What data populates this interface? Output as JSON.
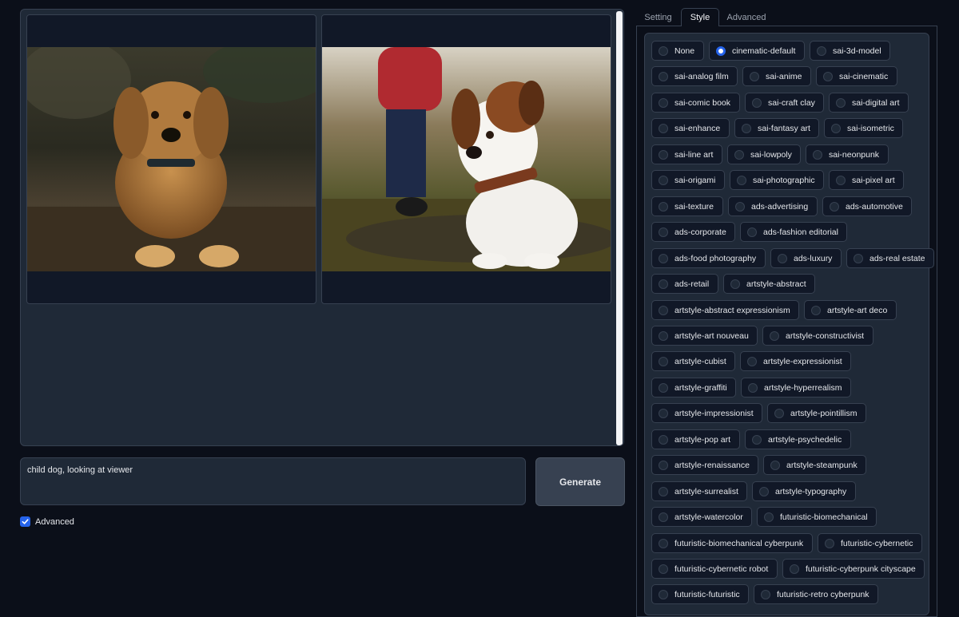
{
  "gallery": {
    "images": [
      {
        "name": "golden-retriever-puppy"
      },
      {
        "name": "jack-russell-puppy"
      }
    ]
  },
  "prompt": {
    "value": "child dog, looking at viewer"
  },
  "generate_label": "Generate",
  "advanced_checkbox": {
    "label": "Advanced",
    "checked": true
  },
  "tabs": [
    {
      "label": "Setting",
      "selected": false
    },
    {
      "label": "Style",
      "selected": true
    },
    {
      "label": "Advanced",
      "selected": false
    }
  ],
  "styles": {
    "selected": "cinematic-default",
    "rows": [
      [
        "None",
        "cinematic-default",
        "sai-3d-model"
      ],
      [
        "sai-analog film",
        "sai-anime",
        "sai-cinematic"
      ],
      [
        "sai-comic book",
        "sai-craft clay",
        "sai-digital art"
      ],
      [
        "sai-enhance",
        "sai-fantasy art",
        "sai-isometric"
      ],
      [
        "sai-line art",
        "sai-lowpoly",
        "sai-neonpunk"
      ],
      [
        "sai-origami",
        "sai-photographic",
        "sai-pixel art"
      ],
      [
        "sai-texture",
        "ads-advertising",
        "ads-automotive"
      ],
      [
        "ads-corporate",
        "ads-fashion editorial"
      ],
      [
        "ads-food photography",
        "ads-luxury",
        "ads-real estate"
      ],
      [
        "ads-retail",
        "artstyle-abstract"
      ],
      [
        "artstyle-abstract expressionism",
        "artstyle-art deco"
      ],
      [
        "artstyle-art nouveau",
        "artstyle-constructivist"
      ],
      [
        "artstyle-cubist",
        "artstyle-expressionist"
      ],
      [
        "artstyle-graffiti",
        "artstyle-hyperrealism"
      ],
      [
        "artstyle-impressionist",
        "artstyle-pointillism"
      ],
      [
        "artstyle-pop art",
        "artstyle-psychedelic"
      ],
      [
        "artstyle-renaissance",
        "artstyle-steampunk"
      ],
      [
        "artstyle-surrealist",
        "artstyle-typography"
      ],
      [
        "artstyle-watercolor",
        "futuristic-biomechanical"
      ],
      [
        "futuristic-biomechanical cyberpunk",
        "futuristic-cybernetic"
      ],
      [
        "futuristic-cybernetic robot",
        "futuristic-cyberpunk cityscape"
      ],
      [
        "futuristic-futuristic",
        "futuristic-retro cyberpunk"
      ]
    ]
  },
  "colors": {
    "background": "#0b0f19",
    "panel": "#1f2937",
    "accent": "#2563eb"
  }
}
